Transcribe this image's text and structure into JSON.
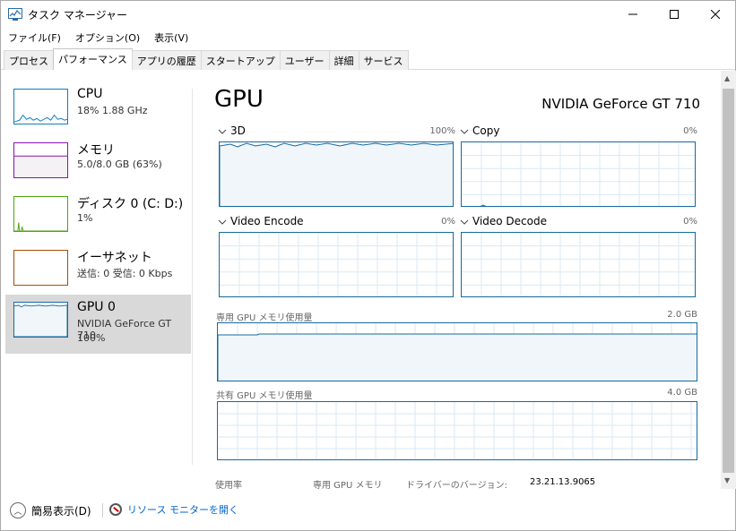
{
  "window": {
    "title": "タスク マネージャー",
    "min_glyph": "—",
    "max_glyph": "☐",
    "close_glyph": "✕"
  },
  "menu": [
    {
      "label": "ファイル(F)"
    },
    {
      "label": "オプション(O)"
    },
    {
      "label": "表示(V)"
    }
  ],
  "tabs": [
    {
      "label": "プロセス",
      "active": false
    },
    {
      "label": "パフォーマンス",
      "active": true
    },
    {
      "label": "アプリの履歴",
      "active": false
    },
    {
      "label": "スタートアップ",
      "active": false
    },
    {
      "label": "ユーザー",
      "active": false
    },
    {
      "label": "詳細",
      "active": false
    },
    {
      "label": "サービス",
      "active": false
    }
  ],
  "sidebar": {
    "items": [
      {
        "title": "CPU",
        "sub": "18%  1.88 GHz",
        "sub2": "",
        "color": "#117dbb"
      },
      {
        "title": "メモリ",
        "sub": "5.0/8.0 GB (63%)",
        "sub2": "",
        "color": "#8b12ae"
      },
      {
        "title": "ディスク 0 (C: D:)",
        "sub": "1%",
        "sub2": "",
        "color": "#4da60c"
      },
      {
        "title": "イーサネット",
        "sub": "送信: 0  受信: 0 Kbps",
        "sub2": "",
        "color": "#a74f01"
      },
      {
        "title": "GPU 0",
        "sub": "NVIDIA GeForce GT 710",
        "sub2": "100%",
        "color": "#17699e"
      }
    ]
  },
  "main": {
    "title": "GPU",
    "gpu_name": "NVIDIA GeForce GT 710",
    "engines": [
      {
        "label": "3D",
        "pct": "100%"
      },
      {
        "label": "Copy",
        "pct": "0%"
      },
      {
        "label": "Video Encode",
        "pct": "0%"
      },
      {
        "label": "Video Decode",
        "pct": "0%"
      }
    ],
    "dedicated_label": "専用 GPU メモリ使用量",
    "dedicated_max": "2.0 GB",
    "shared_label": "共有 GPU メモリ使用量",
    "shared_max": "4.0 GB",
    "stats": {
      "usage_label": "使用率",
      "dedicated_mem_label": "専用 GPU メモリ",
      "driver_label": "ドライバーのバージョン:",
      "driver_value": "23.21.13.9065"
    }
  },
  "footer": {
    "compact_label": "簡易表示(D)",
    "monitor_link": "リソース モニターを開く"
  },
  "colors": {
    "gpu_line": "#17699e",
    "gpu_fill": "#f1f6fa",
    "grid": "#d9eaf4"
  }
}
